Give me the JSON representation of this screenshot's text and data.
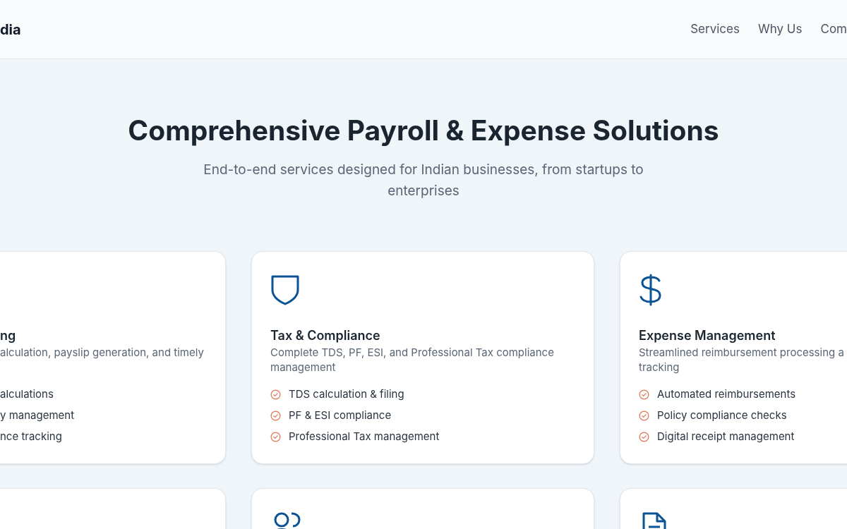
{
  "header": {
    "brand": "dia",
    "nav": [
      "Services",
      "Why Us",
      "Com"
    ]
  },
  "hero": {
    "title": "Comprehensive Payroll & Expense Solutions",
    "subtitle": "End-to-end services designed for Indian businesses, from startups to enterprises"
  },
  "cards": [
    {
      "title": "ng",
      "description_lines": [
        "alculation, payslip generation, and timely"
      ],
      "features": [
        "alculations",
        "y management",
        "nce tracking"
      ]
    },
    {
      "title": "Tax & Compliance",
      "description_lines": [
        "Complete TDS, PF, ESI, and Professional Tax compliance",
        "management"
      ],
      "features": [
        "TDS calculation & filing",
        "PF & ESI compliance",
        "Professional Tax management"
      ]
    },
    {
      "title": "Expense Management",
      "description_lines": [
        "Streamlined reimbursement processing a",
        "tracking"
      ],
      "features": [
        "Automated reimbursements",
        "Policy compliance checks",
        "Digital receipt management"
      ]
    }
  ]
}
